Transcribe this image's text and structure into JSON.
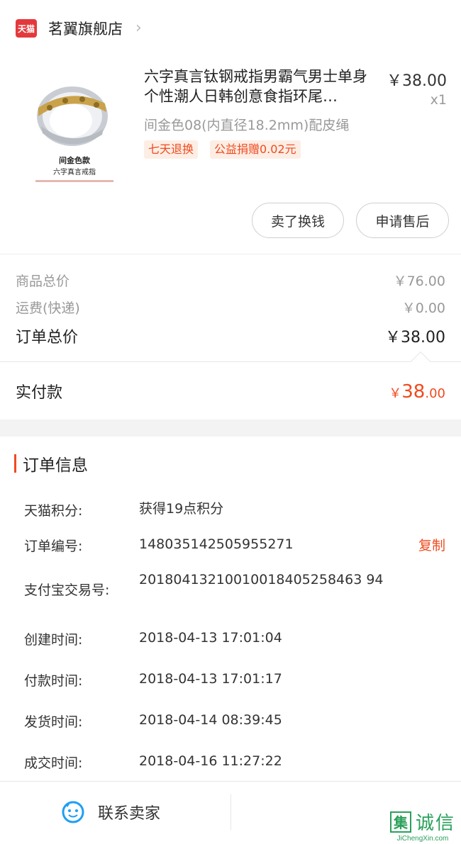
{
  "shop": {
    "badge": "天猫",
    "name": "茗翼旗舰店",
    "chevron": "›"
  },
  "product": {
    "image_caption_main": "间金色款",
    "image_caption_sub": "六字真言戒指",
    "title": "六字真言钛钢戒指男霸气男士单身个性潮人日韩创意食指环尾…",
    "price": "￥38.00",
    "quantity": "x1",
    "sku": "间金色08(内直径18.2mm)配皮绳",
    "tags": [
      "七天退换",
      "公益捐赠0.02元"
    ]
  },
  "actions": {
    "sell": "卖了换钱",
    "aftersale": "申请售后"
  },
  "summary": {
    "goods_label": "商品总价",
    "goods_value": "￥76.00",
    "shipping_label": "运费(快递)",
    "shipping_value": "￥0.00",
    "total_label": "订单总价",
    "total_value": "￥38.00",
    "paid_label": "实付款",
    "paid_symbol": "￥",
    "paid_int": "38",
    "paid_dec": ".00"
  },
  "order_info": {
    "title": "订单信息",
    "copy_label": "复制",
    "rows": [
      {
        "label": "天猫积分:",
        "value": "获得19点积分"
      },
      {
        "label": "订单编号:",
        "value": "148035142505955271"
      },
      {
        "label": "支付宝交易号:",
        "value": "20180413210010018405258463 94"
      },
      {
        "label": "创建时间:",
        "value": "2018-04-13 17:01:04"
      },
      {
        "label": "付款时间:",
        "value": "2018-04-13 17:01:17"
      },
      {
        "label": "发货时间:",
        "value": "2018-04-14 08:39:45"
      },
      {
        "label": "成交时间:",
        "value": "2018-04-16 11:27:22"
      }
    ]
  },
  "bottom": {
    "contact_seller": "联系卖家",
    "contact_icon": "chat-bubble-icon"
  },
  "watermark": {
    "mark": "集",
    "text": "诚信",
    "url": "JiChengXin.com"
  },
  "colors": {
    "accent": "#f04a1e",
    "tmall_red": "#e4393c",
    "icon_blue": "#1e9ff2",
    "watermark_green": "#2aa05a"
  }
}
